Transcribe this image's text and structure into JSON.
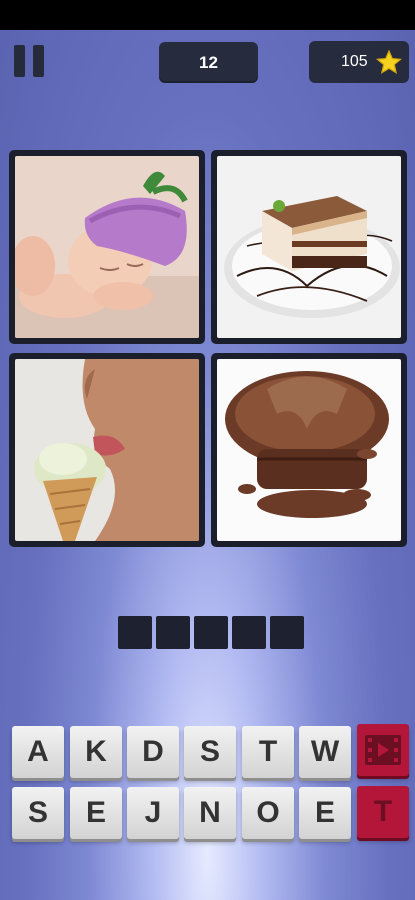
{
  "header": {
    "level": "12",
    "coins": "105",
    "coin_icon": "star-coin-icon",
    "pause_icon": "pause-icon"
  },
  "puzzle": {
    "images": [
      "sleeping baby in purple hat",
      "layered chocolate cake",
      "ice cream cone",
      "chocolate muffin"
    ],
    "answer_slots": 5
  },
  "keyboard": {
    "row1": [
      "A",
      "K",
      "D",
      "S",
      "T",
      "W"
    ],
    "row2": [
      "S",
      "E",
      "J",
      "N",
      "O",
      "E"
    ],
    "skip_icon": "film-play-icon",
    "reveal_letter": "T"
  },
  "colors": {
    "accent": "#b31638",
    "panel": "#262c3e"
  }
}
